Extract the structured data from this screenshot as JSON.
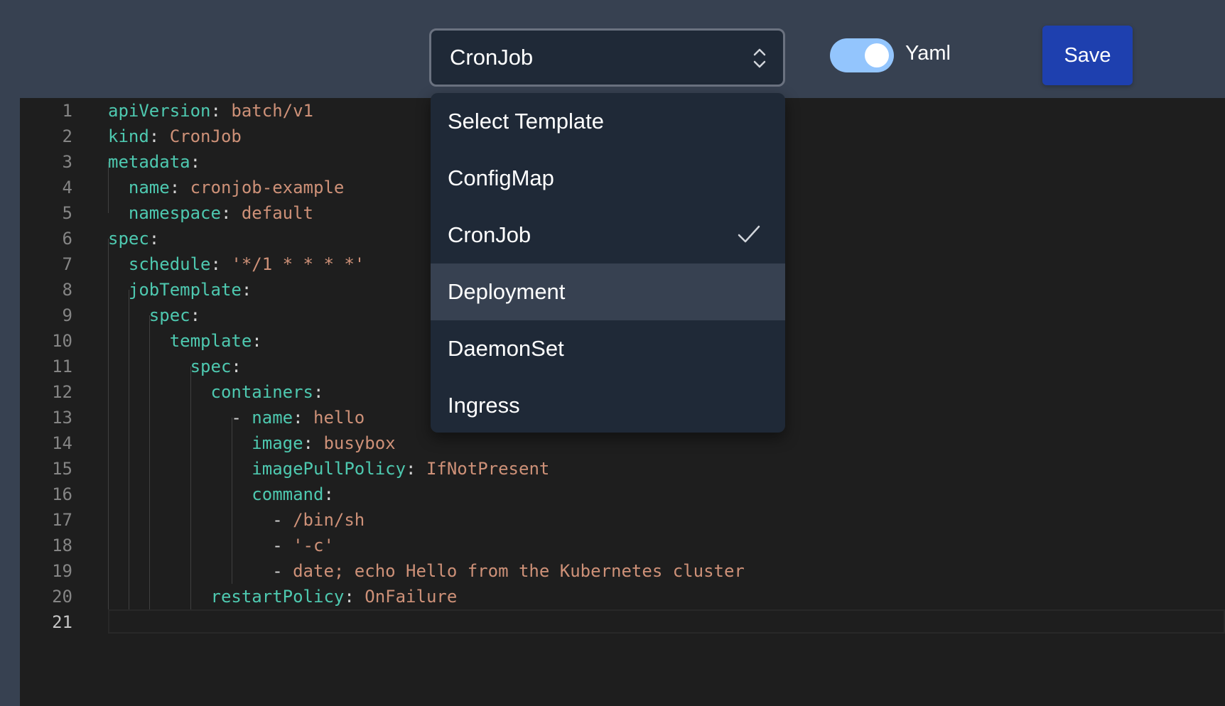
{
  "toolbar": {
    "template_select_value": "CronJob",
    "yaml_toggle_label": "Yaml",
    "yaml_toggle_on": true,
    "save_label": "Save"
  },
  "dropdown": {
    "options": [
      {
        "label": "Select Template",
        "selected": false
      },
      {
        "label": "ConfigMap",
        "selected": false
      },
      {
        "label": "CronJob",
        "selected": true
      },
      {
        "label": "Deployment",
        "selected": false,
        "hovered": true
      },
      {
        "label": "DaemonSet",
        "selected": false
      },
      {
        "label": "Ingress",
        "selected": false
      }
    ]
  },
  "editor": {
    "active_line": 21,
    "lines": [
      {
        "num": "1",
        "indent": "",
        "dash": "",
        "key": "apiVersion",
        "sep": ": ",
        "value": "batch/v1"
      },
      {
        "num": "2",
        "indent": "",
        "dash": "",
        "key": "kind",
        "sep": ": ",
        "value": "CronJob"
      },
      {
        "num": "3",
        "indent": "",
        "dash": "",
        "key": "metadata",
        "sep": ":",
        "value": ""
      },
      {
        "num": "4",
        "indent": "  ",
        "dash": "",
        "key": "name",
        "sep": ": ",
        "value": "cronjob-example"
      },
      {
        "num": "5",
        "indent": "  ",
        "dash": "",
        "key": "namespace",
        "sep": ": ",
        "value": "default"
      },
      {
        "num": "6",
        "indent": "",
        "dash": "",
        "key": "spec",
        "sep": ":",
        "value": ""
      },
      {
        "num": "7",
        "indent": "  ",
        "dash": "",
        "key": "schedule",
        "sep": ": ",
        "value": "'*/1 * * * *'"
      },
      {
        "num": "8",
        "indent": "  ",
        "dash": "",
        "key": "jobTemplate",
        "sep": ":",
        "value": ""
      },
      {
        "num": "9",
        "indent": "    ",
        "dash": "",
        "key": "spec",
        "sep": ":",
        "value": ""
      },
      {
        "num": "10",
        "indent": "      ",
        "dash": "",
        "key": "template",
        "sep": ":",
        "value": ""
      },
      {
        "num": "11",
        "indent": "        ",
        "dash": "",
        "key": "spec",
        "sep": ":",
        "value": ""
      },
      {
        "num": "12",
        "indent": "          ",
        "dash": "",
        "key": "containers",
        "sep": ":",
        "value": ""
      },
      {
        "num": "13",
        "indent": "            ",
        "dash": "- ",
        "key": "name",
        "sep": ": ",
        "value": "hello"
      },
      {
        "num": "14",
        "indent": "              ",
        "dash": "",
        "key": "image",
        "sep": ": ",
        "value": "busybox"
      },
      {
        "num": "15",
        "indent": "              ",
        "dash": "",
        "key": "imagePullPolicy",
        "sep": ": ",
        "value": "IfNotPresent"
      },
      {
        "num": "16",
        "indent": "              ",
        "dash": "",
        "key": "command",
        "sep": ":",
        "value": ""
      },
      {
        "num": "17",
        "indent": "                ",
        "dash": "- ",
        "key": "",
        "sep": "",
        "value": "/bin/sh"
      },
      {
        "num": "18",
        "indent": "                ",
        "dash": "- ",
        "key": "",
        "sep": "",
        "value": "'-c'"
      },
      {
        "num": "19",
        "indent": "                ",
        "dash": "- ",
        "key": "",
        "sep": "",
        "value": "date; echo Hello from the Kubernetes cluster"
      },
      {
        "num": "20",
        "indent": "          ",
        "dash": "",
        "key": "restartPolicy",
        "sep": ": ",
        "value": "OnFailure"
      },
      {
        "num": "21",
        "indent": "",
        "dash": "",
        "key": "",
        "sep": "",
        "value": ""
      }
    ]
  }
}
